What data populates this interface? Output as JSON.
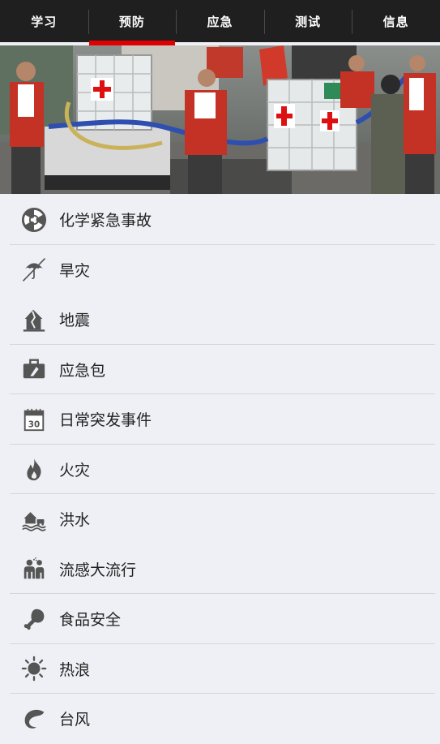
{
  "tabs": [
    {
      "label": "学习"
    },
    {
      "label": "预防"
    },
    {
      "label": "应急"
    },
    {
      "label": "测试"
    },
    {
      "label": "信息"
    }
  ],
  "active_tab": "预防",
  "colors": {
    "topbar": "#1f1f1f",
    "accent": "#e00000",
    "background": "#eff0f5",
    "icon": "#555555"
  },
  "items": [
    {
      "label": "化学紧急事故",
      "icon": "radiation-icon"
    },
    {
      "label": "旱灾",
      "icon": "no-umbrella-icon"
    },
    {
      "label": "地震",
      "icon": "earthquake-house-icon"
    },
    {
      "label": "应急包",
      "icon": "kit-bag-icon"
    },
    {
      "label": "日常突发事件",
      "icon": "calendar-icon"
    },
    {
      "label": "火灾",
      "icon": "flame-icon"
    },
    {
      "label": "洪水",
      "icon": "flood-icon"
    },
    {
      "label": "流感大流行",
      "icon": "flu-people-icon"
    },
    {
      "label": "食品安全",
      "icon": "drumstick-icon"
    },
    {
      "label": "热浪",
      "icon": "sun-icon"
    },
    {
      "label": "台风",
      "icon": "typhoon-icon"
    }
  ],
  "hero_calendar_number": "30"
}
